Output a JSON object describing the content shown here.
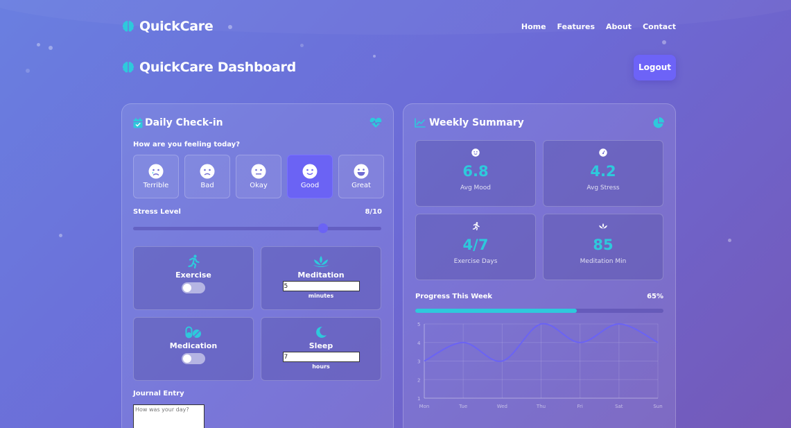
{
  "nav": {
    "brand": "QuickCare",
    "links": [
      "Home",
      "Features",
      "About",
      "Contact"
    ]
  },
  "header": {
    "title": "QuickCare Dashboard",
    "logout_label": "Logout"
  },
  "checkin": {
    "title": "Daily Check-in",
    "question": "How are you feeling today?",
    "moods": [
      {
        "label": "Terrible",
        "icon": "sad-tear-icon"
      },
      {
        "label": "Bad",
        "icon": "frown-icon"
      },
      {
        "label": "Okay",
        "icon": "meh-icon"
      },
      {
        "label": "Good",
        "icon": "smile-icon"
      },
      {
        "label": "Great",
        "icon": "grin-icon"
      }
    ],
    "selected_mood": "Good",
    "stress_label": "Stress Level",
    "stress_value_text": "8/10",
    "stress_value": 8,
    "stress_max": 10,
    "exercise": {
      "label": "Exercise",
      "enabled": false
    },
    "meditation": {
      "label": "Meditation",
      "value": "5",
      "unit": "minutes"
    },
    "medication": {
      "label": "Medication",
      "enabled": false
    },
    "sleep": {
      "label": "Sleep",
      "value": "7",
      "unit": "hours"
    },
    "journal_label": "Journal Entry",
    "journal_placeholder": "How was your day?"
  },
  "summary": {
    "title": "Weekly Summary",
    "stats": [
      {
        "value": "6.8",
        "label": "Avg Mood",
        "icon": "smile-icon"
      },
      {
        "value": "4.2",
        "label": "Avg Stress",
        "icon": "gauge-icon"
      },
      {
        "value": "4/7",
        "label": "Exercise Days",
        "icon": "running-icon"
      },
      {
        "value": "85",
        "label": "Meditation Min",
        "icon": "lotus-icon"
      }
    ],
    "progress_label": "Progress This Week",
    "progress_text": "65%",
    "progress_value": 65
  },
  "colors": {
    "accent": "#2ec9dc",
    "primary": "#6b63f4"
  },
  "chart_data": {
    "type": "line",
    "categories": [
      "Mon",
      "Tue",
      "Wed",
      "Thu",
      "Fri",
      "Sat",
      "Sun"
    ],
    "series": [
      {
        "values": [
          3,
          4,
          3,
          5,
          4,
          5,
          4
        ]
      }
    ],
    "yticks": [
      1,
      2,
      3,
      4,
      5
    ],
    "ylim": [
      1,
      5
    ],
    "grid": true,
    "smooth": true,
    "color": "#6b63f4"
  }
}
